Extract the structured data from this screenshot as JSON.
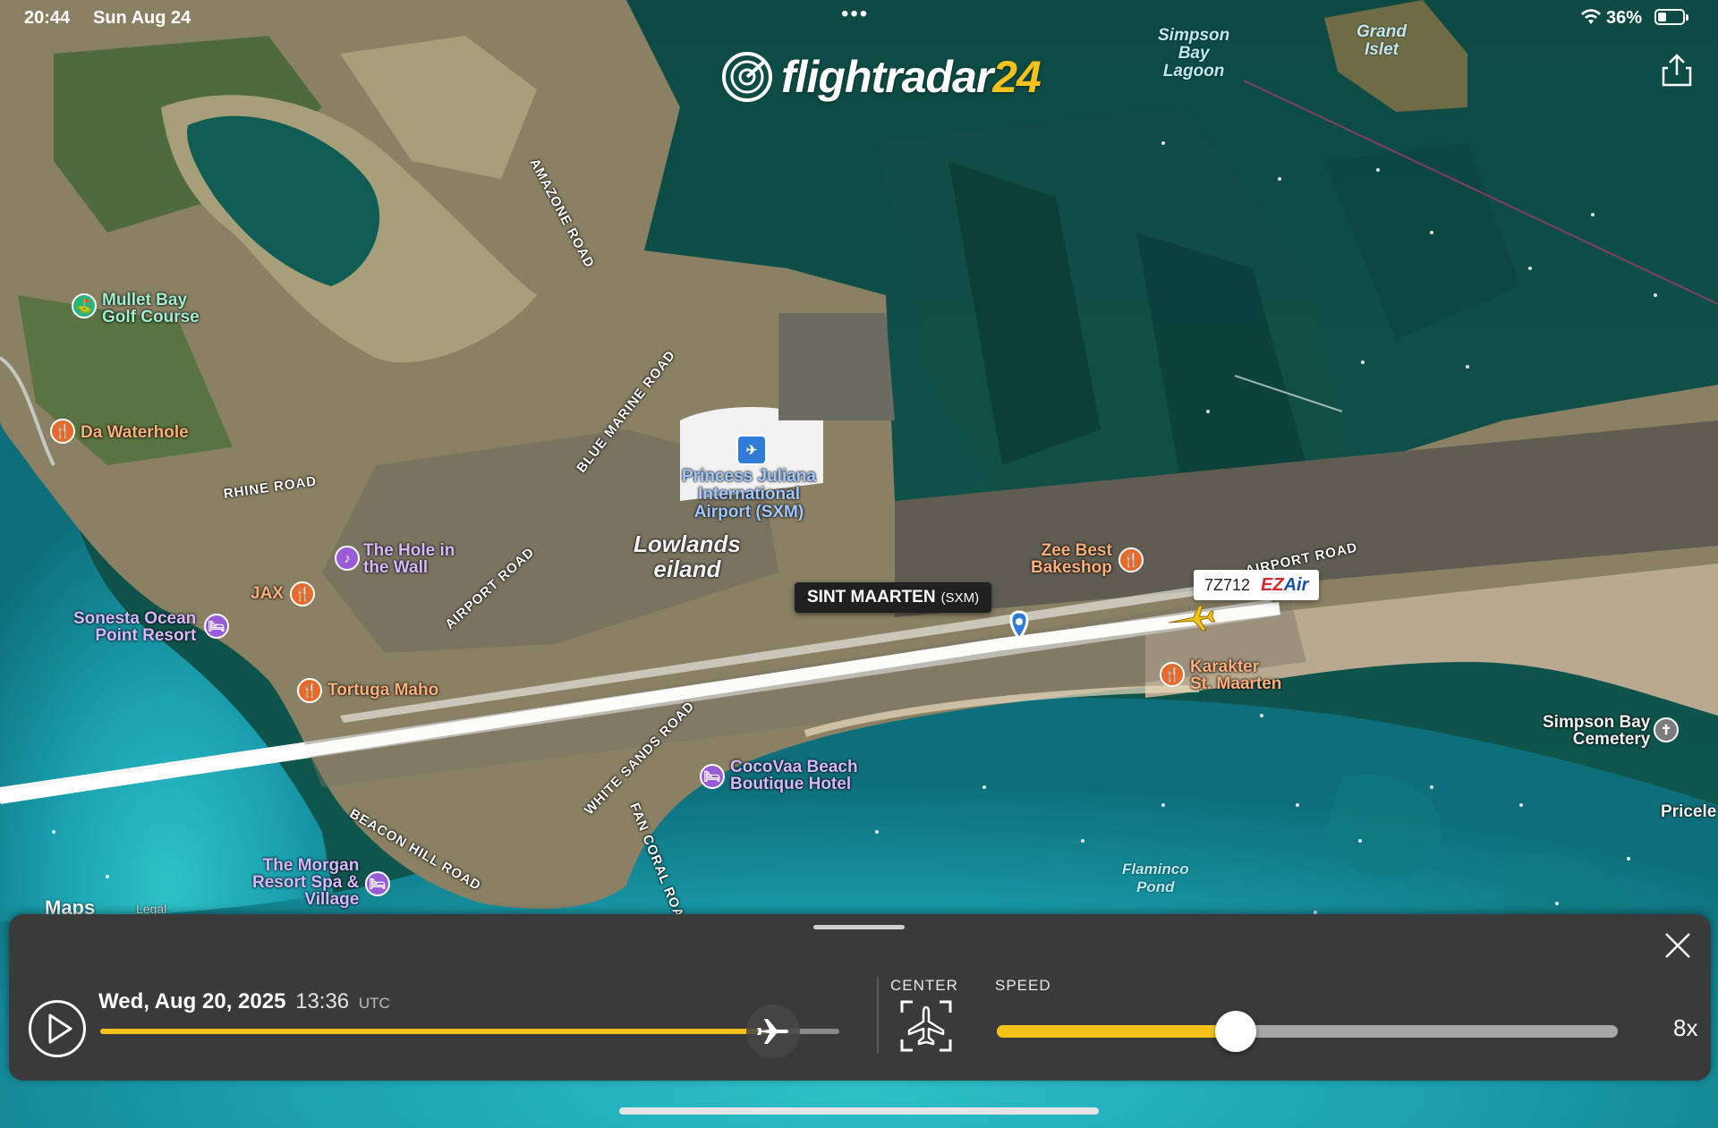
{
  "status_bar": {
    "time": "20:44",
    "date": "Sun Aug 24",
    "dots": "•••",
    "battery": "36%",
    "icons": [
      "wifi-icon",
      "battery-icon"
    ]
  },
  "app": {
    "logo_text": "flightradar",
    "logo_number": "24"
  },
  "map": {
    "places": {
      "mullet_bay_1": "Mullet Bay",
      "mullet_bay_2": "Golf Course",
      "da_waterhole": "Da Waterhole",
      "hole_wall_1": "The Hole in",
      "hole_wall_2": "the Wall",
      "jax": "JAX",
      "sonesta_1": "Sonesta Ocean",
      "sonesta_2": "Point Resort",
      "tortuga": "Tortuga Maho",
      "airport_1": "Princess Juliana",
      "airport_2": "International",
      "airport_3": "Airport (SXM)",
      "lowlands_1": "Lowlands",
      "lowlands_2": "eiland",
      "zee_best_1": "Zee Best",
      "zee_best_2": "Bakeshop",
      "karakter_1": "Karakter",
      "karakter_2": "St. Maarten",
      "cocovaa_1": "CocoVaa Beach",
      "cocovaa_2": "Boutique Hotel",
      "simpson_cem_1": "Simpson Bay",
      "simpson_cem_2": "Cemetery",
      "morgan_1": "The Morgan",
      "morgan_2": "Resort Spa &",
      "morgan_3": "Village",
      "simpson_lagoon_1": "Simpson",
      "simpson_lagoon_2": "Bay",
      "simpson_lagoon_3": "Lagoon",
      "grand_islet_1": "Grand",
      "grand_islet_2": "Islet",
      "flaminco_1": "Flaminco",
      "flaminco_2": "Pond",
      "pricele": "Pricele"
    },
    "roads": {
      "amazone": "AMAZONE ROAD",
      "blue_marine": "BLUE MARINE ROAD",
      "rhine": "RHINE ROAD",
      "airport_road_w": "AIRPORT ROAD",
      "airport_road_e": "AIRPORT ROAD",
      "white_sands": "WHITE SANDS ROAD",
      "fan_coral": "FAN CORAL ROAD",
      "beacon_hill": "BEACON HILL ROAD"
    },
    "airport_tag": {
      "name": "SINT MAARTEN",
      "code": "(SXM)"
    },
    "flight_tag": {
      "flight_id": "7Z712",
      "airline_ez": "EZ",
      "airline_air": "Air"
    },
    "attribution": {
      "brand": "Maps",
      "legal": "Legal"
    }
  },
  "playback": {
    "date": "Wed, Aug 20, 2025",
    "time": "13:36",
    "timezone": "UTC",
    "timeline_progress": 0.91,
    "center_label": "CENTER",
    "speed_label": "SPEED",
    "speed_value": "8x",
    "speed_slider_fraction": 0.385
  },
  "colors": {
    "accent": "#f4c21a",
    "panel_bg": "#3a3a3a"
  }
}
